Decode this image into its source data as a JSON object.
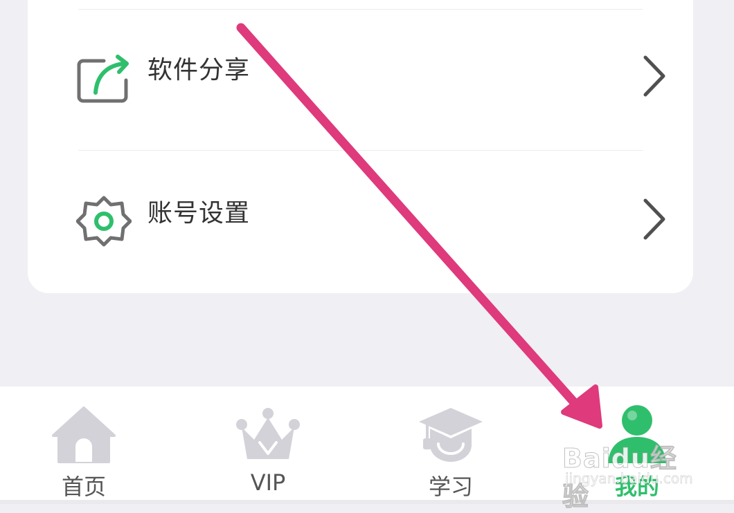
{
  "menu": {
    "items": [
      {
        "label": "软件分享",
        "icon": "share-icon"
      },
      {
        "label": "账号设置",
        "icon": "gear-icon"
      }
    ]
  },
  "tabbar": {
    "tabs": [
      {
        "label": "首页",
        "icon": "home-icon",
        "active": false
      },
      {
        "label": "VIP",
        "icon": "crown-icon",
        "active": false
      },
      {
        "label": "学习",
        "icon": "graduation-cap-icon",
        "active": false
      },
      {
        "label": "我的",
        "icon": "user-icon",
        "active": true
      }
    ]
  },
  "watermark": {
    "brand": "Baidu经验",
    "domain": "jingyan.baidu.com"
  },
  "colors": {
    "accent": "#2fbf6c",
    "arrow": "#de3a7c",
    "icon_gray": "#d2d2d8",
    "text": "#333333"
  }
}
